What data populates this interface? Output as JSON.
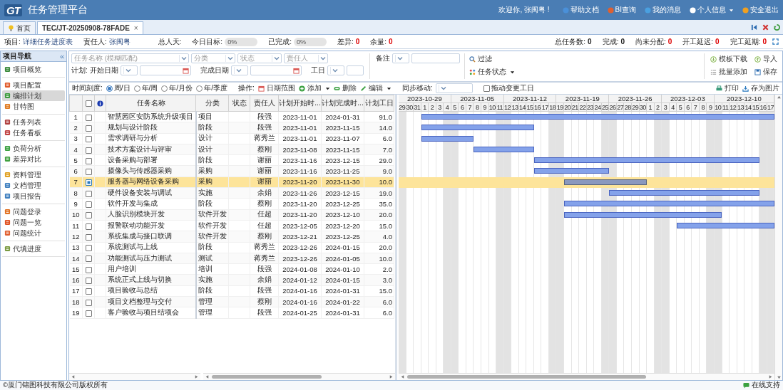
{
  "header": {
    "logo": "GT",
    "title": "任务管理平台",
    "welcome": "欢迎你, 张闽粤 !",
    "links": [
      "帮助文档",
      "BI查询",
      "我的消息",
      "个人信息",
      "安全退出"
    ]
  },
  "tabs": [
    {
      "label": "首页",
      "selected": false,
      "closable": false
    },
    {
      "label": "TEC/JT-20250908-78FADE",
      "selected": true,
      "closable": true
    }
  ],
  "tab_close": "×",
  "info": {
    "project_label": "项目:",
    "project": "详细任务进度表",
    "owner_label": "责任人:",
    "owner": "张闽粤",
    "mandays_label": "总人天:",
    "target_label": "今日目标:",
    "target": {
      "text": "0%",
      "level": 0
    },
    "done_label": "已完成:",
    "done": {
      "text": "0%",
      "level": 0
    },
    "diff_label": "差异:",
    "diff": "0",
    "rest_label": "余量:",
    "rest": "0",
    "stats": [
      {
        "label": "总任务数:",
        "value": "0"
      },
      {
        "label": "完成:",
        "value": "0"
      },
      {
        "label": "尚未分配:",
        "value": "0"
      },
      {
        "label": "开工延迟:",
        "value": "0"
      },
      {
        "label": "完工延期:",
        "value": "0"
      }
    ]
  },
  "sidebar": {
    "title": "项目导航",
    "collapse": "«",
    "groups": [
      [
        {
          "label": "项目概览",
          "selected": false
        }
      ],
      [
        {
          "label": "项目配置",
          "selected": false
        },
        {
          "label": "编排计划",
          "selected": true
        },
        {
          "label": "甘特图",
          "selected": false
        }
      ],
      [
        {
          "label": "任务列表",
          "selected": false
        },
        {
          "label": "任务看板",
          "selected": false
        }
      ],
      [
        {
          "label": "负荷分析",
          "selected": false
        },
        {
          "label": "差异对比",
          "selected": false
        }
      ],
      [
        {
          "label": "资料管理",
          "selected": false
        },
        {
          "label": "文档管理",
          "selected": false
        },
        {
          "label": "项目报告",
          "selected": false
        }
      ],
      [
        {
          "label": "问题登录",
          "selected": false
        },
        {
          "label": "问题一览",
          "selected": false
        },
        {
          "label": "问题统计",
          "selected": false
        }
      ],
      [
        {
          "label": "代填进度",
          "selected": false
        }
      ]
    ]
  },
  "filters": {
    "name_placeholder": "任务名称 (模糊匹配)",
    "combos": [
      "分类",
      "状态",
      "责任人"
    ],
    "plan_label": "计划: 开始日期",
    "finish_label": "完成日期",
    "workdays_label": "工日",
    "remark_label": "备注",
    "filter_button": "过滤",
    "status_button": "任务状态"
  },
  "actions": [
    "模板下载",
    "导入",
    "批量添加",
    "保存"
  ],
  "toolbar": {
    "scale_label": "时间刻度:",
    "scales": [
      {
        "label": "周/日",
        "selected": true
      },
      {
        "label": "年/周",
        "selected": false
      },
      {
        "label": "年/月份",
        "selected": false
      },
      {
        "label": "年/季度",
        "selected": false
      }
    ],
    "ops_label": "操作:",
    "ops": [
      {
        "label": "日期范围",
        "kind": "calendar"
      },
      {
        "label": "添加",
        "kind": "add"
      },
      {
        "label": "删除",
        "kind": "delete"
      },
      {
        "label": "编辑",
        "kind": "edit"
      }
    ],
    "sync_label": "同步移动:",
    "drag_label": "拖动变更工日",
    "drag_checked": false,
    "print": "打印",
    "save_image": "存为图片"
  },
  "table": {
    "select_all_checked": false,
    "columns": [
      "任务名称",
      "分类",
      "状态",
      "责任人",
      "计划开始时...",
      "计划完成时...",
      "计划工日"
    ],
    "rows": [
      {
        "no": "1",
        "name": "智慧园区安防系统升级项目",
        "category": "项目",
        "owner": "段强",
        "start": "2023-11-01",
        "end": "2024-01-31",
        "days": "91.0",
        "checked": false,
        "selected": false
      },
      {
        "no": "2",
        "name": "规划与设计阶段",
        "category": "阶段",
        "owner": "段强",
        "start": "2023-11-01",
        "end": "2023-11-15",
        "days": "14.0",
        "checked": false,
        "selected": false
      },
      {
        "no": "3",
        "name": "需求调研与分析",
        "category": "设计",
        "owner": "蒋秀兰",
        "start": "2023-11-01",
        "end": "2023-11-07",
        "days": "6.0",
        "checked": false,
        "selected": false
      },
      {
        "no": "4",
        "name": "技术方案设计与评审",
        "category": "设计",
        "owner": "蔡刚",
        "start": "2023-11-08",
        "end": "2023-11-15",
        "days": "7.0",
        "checked": false,
        "selected": false
      },
      {
        "no": "5",
        "name": "设备采购与部署",
        "category": "阶段",
        "owner": "谢丽",
        "start": "2023-11-16",
        "end": "2023-12-15",
        "days": "29.0",
        "checked": false,
        "selected": false
      },
      {
        "no": "6",
        "name": "摄像头与传感器采购",
        "category": "采购",
        "owner": "谢丽",
        "start": "2023-11-16",
        "end": "2023-11-25",
        "days": "9.0",
        "checked": false,
        "selected": false
      },
      {
        "no": "7",
        "name": "服务器与网络设备采购",
        "category": "采购",
        "owner": "谢丽",
        "start": "2023-11-20",
        "end": "2023-11-30",
        "days": "10.0",
        "checked": true,
        "selected": true
      },
      {
        "no": "8",
        "name": "硬件设备安装与调试",
        "category": "实施",
        "owner": "余娟",
        "start": "2023-11-26",
        "end": "2023-12-15",
        "days": "19.0",
        "checked": false,
        "selected": false
      },
      {
        "no": "9",
        "name": "软件开发与集成",
        "category": "阶段",
        "owner": "蔡刚",
        "start": "2023-11-20",
        "end": "2023-12-25",
        "days": "35.0",
        "checked": false,
        "selected": false
      },
      {
        "no": "10",
        "name": "人脸识别模块开发",
        "category": "软件开发",
        "owner": "任超",
        "start": "2023-11-20",
        "end": "2023-12-10",
        "days": "20.0",
        "checked": false,
        "selected": false
      },
      {
        "no": "11",
        "name": "报警联动功能开发",
        "category": "软件开发",
        "owner": "任超",
        "start": "2023-12-05",
        "end": "2023-12-20",
        "days": "15.0",
        "checked": false,
        "selected": false
      },
      {
        "no": "12",
        "name": "系统集成与接口联调",
        "category": "软件开发",
        "owner": "蔡刚",
        "start": "2023-12-21",
        "end": "2023-12-25",
        "days": "4.0",
        "checked": false,
        "selected": false
      },
      {
        "no": "13",
        "name": "系统测试与上线",
        "category": "阶段",
        "owner": "蒋秀兰",
        "start": "2023-12-26",
        "end": "2024-01-15",
        "days": "20.0",
        "checked": false,
        "selected": false
      },
      {
        "no": "14",
        "name": "功能测试与压力测试",
        "category": "测试",
        "owner": "蒋秀兰",
        "start": "2023-12-26",
        "end": "2024-01-05",
        "days": "10.0",
        "checked": false,
        "selected": false
      },
      {
        "no": "15",
        "name": "用户培训",
        "category": "培训",
        "owner": "段强",
        "start": "2024-01-08",
        "end": "2024-01-10",
        "days": "2.0",
        "checked": false,
        "selected": false
      },
      {
        "no": "16",
        "name": "系统正式上线与切换",
        "category": "实施",
        "owner": "余娟",
        "start": "2024-01-12",
        "end": "2024-01-15",
        "days": "3.0",
        "checked": false,
        "selected": false
      },
      {
        "no": "17",
        "name": "项目验收与总结",
        "category": "阶段",
        "owner": "段强",
        "start": "2024-01-16",
        "end": "2024-01-31",
        "days": "15.0",
        "checked": false,
        "selected": false
      },
      {
        "no": "18",
        "name": "项目文档整理与交付",
        "category": "管理",
        "owner": "蔡刚",
        "start": "2024-01-16",
        "end": "2024-01-22",
        "days": "6.0",
        "checked": false,
        "selected": false
      },
      {
        "no": "19",
        "name": "客户验收与项目结项会",
        "category": "管理",
        "owner": "段强",
        "start": "2024-01-25",
        "end": "2024-01-31",
        "days": "6.0",
        "checked": false,
        "selected": false
      }
    ]
  },
  "gantt": {
    "weeks": [
      "2023-10-29",
      "2023-11-05",
      "2023-11-12",
      "2023-11-19",
      "2023-11-26",
      "2023-12-03",
      "2023-12-10"
    ],
    "days": [
      {
        "label": "29",
        "weekend": true
      },
      {
        "label": "30",
        "weekend": false
      },
      {
        "label": "31",
        "weekend": false
      },
      {
        "label": "1",
        "weekend": false
      },
      {
        "label": "2",
        "weekend": false
      },
      {
        "label": "3",
        "weekend": false
      },
      {
        "label": "4",
        "weekend": true
      },
      {
        "label": "5",
        "weekend": true
      },
      {
        "label": "6",
        "weekend": false
      },
      {
        "label": "7",
        "weekend": false
      },
      {
        "label": "8",
        "weekend": false
      },
      {
        "label": "9",
        "weekend": false
      },
      {
        "label": "10",
        "weekend": false
      },
      {
        "label": "11",
        "weekend": true
      },
      {
        "label": "12",
        "weekend": true
      },
      {
        "label": "13",
        "weekend": false
      },
      {
        "label": "14",
        "weekend": false
      },
      {
        "label": "15",
        "weekend": false
      },
      {
        "label": "16",
        "weekend": false
      },
      {
        "label": "17",
        "weekend": false
      },
      {
        "label": "18",
        "weekend": true
      },
      {
        "label": "19",
        "weekend": true
      },
      {
        "label": "20",
        "weekend": false
      },
      {
        "label": "21",
        "weekend": false
      },
      {
        "label": "22",
        "weekend": false
      },
      {
        "label": "23",
        "weekend": false
      },
      {
        "label": "24",
        "weekend": false
      },
      {
        "label": "25",
        "weekend": true
      },
      {
        "label": "26",
        "weekend": true
      },
      {
        "label": "27",
        "weekend": false
      },
      {
        "label": "28",
        "weekend": false
      },
      {
        "label": "29",
        "weekend": false
      },
      {
        "label": "30",
        "weekend": false
      },
      {
        "label": "1",
        "weekend": false
      },
      {
        "label": "2",
        "weekend": true
      },
      {
        "label": "3",
        "weekend": true
      },
      {
        "label": "4",
        "weekend": false
      },
      {
        "label": "5",
        "weekend": false
      },
      {
        "label": "6",
        "weekend": false
      },
      {
        "label": "7",
        "weekend": false
      },
      {
        "label": "8",
        "weekend": false
      },
      {
        "label": "9",
        "weekend": true
      },
      {
        "label": "10",
        "weekend": true
      },
      {
        "label": "11",
        "weekend": false
      },
      {
        "label": "12",
        "weekend": false
      },
      {
        "label": "13",
        "weekend": false
      },
      {
        "label": "14",
        "weekend": false
      },
      {
        "label": "15",
        "weekend": false
      },
      {
        "label": "16",
        "weekend": true
      },
      {
        "label": "17",
        "weekend": true
      }
    ]
  },
  "footer": {
    "copyright": "©厦门锦图科技有限公司版权所有",
    "support": "在线支持"
  }
}
